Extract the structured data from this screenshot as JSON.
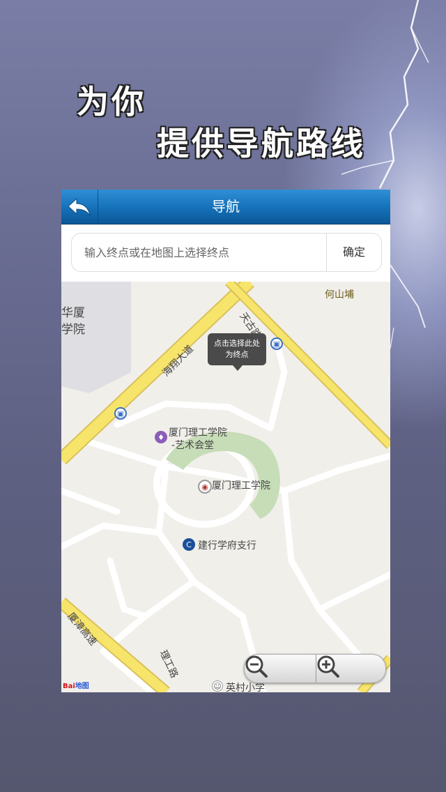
{
  "promo": {
    "line1": "为你",
    "line2": "提供导航路线"
  },
  "nav": {
    "title": "导航",
    "back_icon": "back-arrow-icon"
  },
  "search": {
    "placeholder": "输入终点或在地图上选择终点",
    "value": "",
    "confirm_label": "确定"
  },
  "map": {
    "tooltip_line1": "点击选择此处",
    "tooltip_line2": "为终点",
    "labels": {
      "huaxia": "华厦",
      "huaxia_sub": "学院",
      "heshanpu": "何山埔",
      "tiangu_road": "天古路",
      "haixiang_avenue": "海翔大道",
      "art_hall_1": "厦门理工学院",
      "art_hall_2": "-艺术会堂",
      "xmut": "厦门理工学院",
      "ccb": "建行学府支行",
      "yingcun_school": "英村小学",
      "xiamen_expressway": "厦漳高速",
      "lishan_road": "理工路"
    },
    "zoom_out_icon": "zoom-out-icon",
    "zoom_in_icon": "zoom-in-icon",
    "logo_text": "Bai",
    "logo_suffix": "地图"
  },
  "colors": {
    "nav_blue": "#1570b8",
    "road_yellow": "#f7e46b",
    "green_area": "#c6ddb8"
  }
}
